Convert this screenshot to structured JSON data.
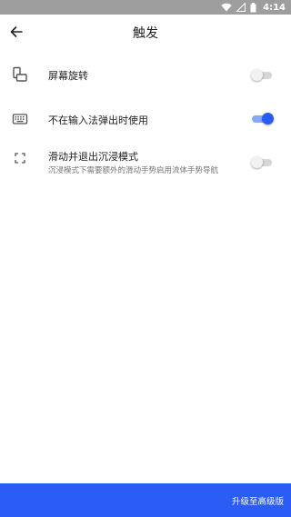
{
  "status_bar": {
    "time": "4:14",
    "icons": [
      "wifi-icon",
      "signal-icon",
      "battery-icon"
    ]
  },
  "header": {
    "back_icon": "arrow-left-icon",
    "title": "触发"
  },
  "settings": [
    {
      "icon": "screen-rotation-icon",
      "label": "屏幕旋转",
      "enabled": false
    },
    {
      "icon": "keyboard-icon",
      "label": "不在输入法弹出时使用",
      "enabled": true
    },
    {
      "icon": "fullscreen-icon",
      "label": "滑动并退出沉浸模式",
      "description": "沉浸模式下需要额外的滑动手势启用流体手势导航",
      "enabled": false
    }
  ],
  "footer": {
    "upgrade_label": "升级至高级版"
  },
  "colors": {
    "accent": "#2b5cf5",
    "status_bar": "#9e9e9e",
    "switch_on_thumb": "#2a5bf0",
    "switch_on_track": "#8aa8f8",
    "switch_off_track": "#d6d6d6"
  }
}
